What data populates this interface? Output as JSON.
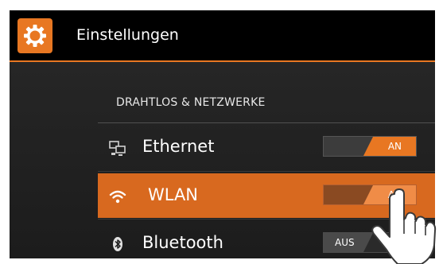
{
  "header": {
    "title": "Einstellungen",
    "icon": "gear-icon",
    "accent_color": "#e87722"
  },
  "section": {
    "title": "DRAHTLOS & NETZWERKE"
  },
  "rows": [
    {
      "label": "Ethernet",
      "icon": "ethernet-icon",
      "toggle": "AN",
      "state": "on"
    },
    {
      "label": "WLAN",
      "icon": "wifi-icon",
      "toggle": "AN",
      "state": "on",
      "selected": true
    },
    {
      "label": "Bluetooth",
      "icon": "bluetooth-icon",
      "toggle": "AUS",
      "state": "off"
    }
  ],
  "pointer": {
    "icon": "pointing-hand-icon"
  }
}
